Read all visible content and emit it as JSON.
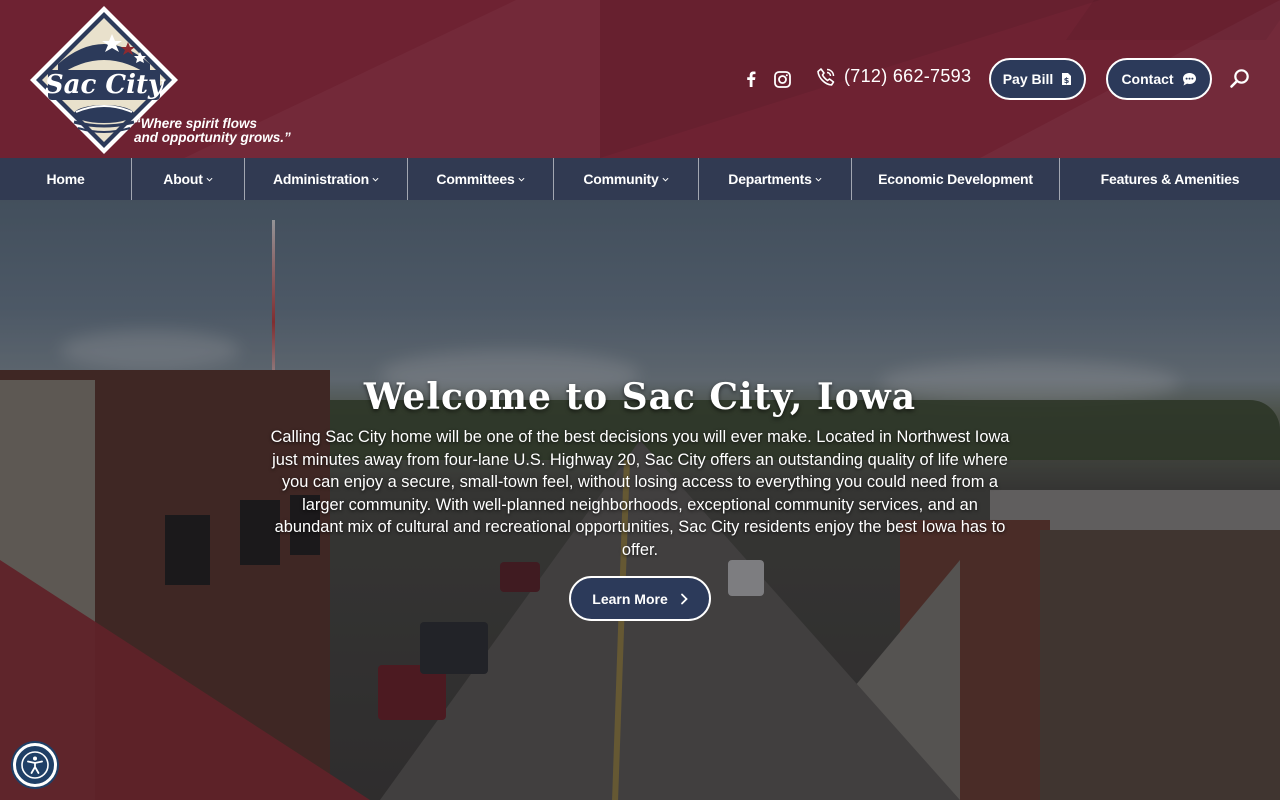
{
  "header": {
    "logo_text": "Sac City",
    "tagline_line1": "“Where spirit flows",
    "tagline_line2": "and opportunity grows.”",
    "phone": "(712) 662-7593",
    "pay_bill_label": "Pay Bill",
    "contact_label": "Contact",
    "icons": [
      "facebook-icon",
      "instagram-icon",
      "phone-icon",
      "bill-icon",
      "chat-icon",
      "search-icon"
    ]
  },
  "nav": {
    "items": [
      {
        "label": "Home",
        "dropdown": false
      },
      {
        "label": "About",
        "dropdown": true
      },
      {
        "label": "Administration",
        "dropdown": true
      },
      {
        "label": "Committees",
        "dropdown": true
      },
      {
        "label": "Community",
        "dropdown": true
      },
      {
        "label": "Departments",
        "dropdown": true
      },
      {
        "label": "Economic Development",
        "dropdown": false
      },
      {
        "label": "Features & Amenities",
        "dropdown": false
      }
    ]
  },
  "hero": {
    "title": "Welcome to Sac City, Iowa",
    "body": "Calling Sac City home will be one of the best decisions you will ever make. Located in Northwest Iowa just minutes away from four-lane U.S. Highway 20, Sac City offers an outstanding quality of life where you can enjoy a secure, small-town feel, without losing access to everything you could need from a larger community. With well-planned neighborhoods, exceptional community services, and an abundant mix of cultural and recreational opportunities, Sac City residents enjoy the best Iowa has to offer.",
    "cta_label": "Learn More"
  },
  "colors": {
    "header_bg": "#6e2232",
    "nav_bg": "#303a54",
    "button_bg": "#2c3a5a",
    "accent_red": "#8d2a30"
  }
}
